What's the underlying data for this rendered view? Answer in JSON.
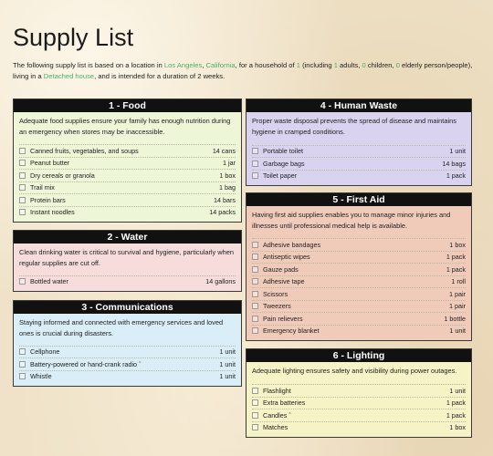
{
  "page": {
    "title": "Supply List",
    "intro": {
      "part1": "The following supply list is based on a location in ",
      "city": "Los Angeles",
      "sep": ", ",
      "state": "California",
      "part2": ", for a household of ",
      "total": "1",
      "part3": " (including ",
      "adults": "1",
      "part4": " adults, ",
      "children": "0",
      "part5": " children, ",
      "elderly": "0",
      "part6": " elderly person/people), living in a ",
      "housing": "Detached house",
      "part7": ", and is intended for a duration of 2 weeks."
    }
  },
  "colors": {
    "highlight": "#4caf6a",
    "header": "#111111"
  },
  "cards": {
    "food": {
      "title": "1 - Food",
      "desc": "Adequate food supplies ensure your family has enough nutrition during an emergency when stores may be inaccessible.",
      "items": [
        {
          "name": "Canned fruits, vegetables, and soups",
          "qty": "14 cans"
        },
        {
          "name": "Peanut butter",
          "qty": "1 jar"
        },
        {
          "name": "Dry cereals or granola",
          "qty": "1 box"
        },
        {
          "name": "Trail mix",
          "qty": "1 bag"
        },
        {
          "name": "Protein bars",
          "qty": "14 bars"
        },
        {
          "name": "Instant noodles",
          "qty": "14 packs"
        }
      ]
    },
    "water": {
      "title": "2 - Water",
      "desc": "Clean drinking water is critical to survival and hygiene, particularly when regular supplies are cut off.",
      "items": [
        {
          "name": "Bottled water",
          "qty": "14 gallons"
        }
      ]
    },
    "communications": {
      "title": "3 - Communications",
      "desc": "Staying informed and connected with emergency services and loved ones is crucial during disasters.",
      "items": [
        {
          "name": "Cellphone",
          "qty": "1 unit"
        },
        {
          "name": "Battery-powered or hand-crank radio ˆ",
          "qty": "1 unit"
        },
        {
          "name": "Whistle",
          "qty": "1 unit"
        }
      ]
    },
    "waste": {
      "title": "4 - Human Waste",
      "desc": "Proper waste disposal prevents the spread of disease and maintains hygiene in cramped conditions.",
      "items": [
        {
          "name": "Portable toilet",
          "qty": "1 unit"
        },
        {
          "name": "Garbage bags",
          "qty": "14 bags"
        },
        {
          "name": "Toilet paper",
          "qty": "1 pack"
        }
      ]
    },
    "firstaid": {
      "title": "5 - First Aid",
      "desc": "Having first aid supplies enables you to manage minor injuries and illnesses until professional medical help is available.",
      "items": [
        {
          "name": "Adhesive bandages",
          "qty": "1 box"
        },
        {
          "name": "Antiseptic wipes",
          "qty": "1 pack"
        },
        {
          "name": "Gauze pads",
          "qty": "1 pack"
        },
        {
          "name": "Adhesive tape",
          "qty": "1 roll"
        },
        {
          "name": "Scissors",
          "qty": "1 pair"
        },
        {
          "name": "Tweezers",
          "qty": "1 pair"
        },
        {
          "name": "Pain relievers",
          "qty": "1 bottle"
        },
        {
          "name": "Emergency blanket",
          "qty": "1 unit"
        }
      ]
    },
    "lighting": {
      "title": "6 - Lighting",
      "desc": "Adequate lighting ensures safety and visibility during power outages.",
      "items": [
        {
          "name": "Flashlight",
          "qty": "1 unit"
        },
        {
          "name": "Extra batteries",
          "qty": "1 pack"
        },
        {
          "name": "Candles ˆ",
          "qty": "1 pack"
        },
        {
          "name": "Matches",
          "qty": "1 box"
        }
      ]
    }
  }
}
